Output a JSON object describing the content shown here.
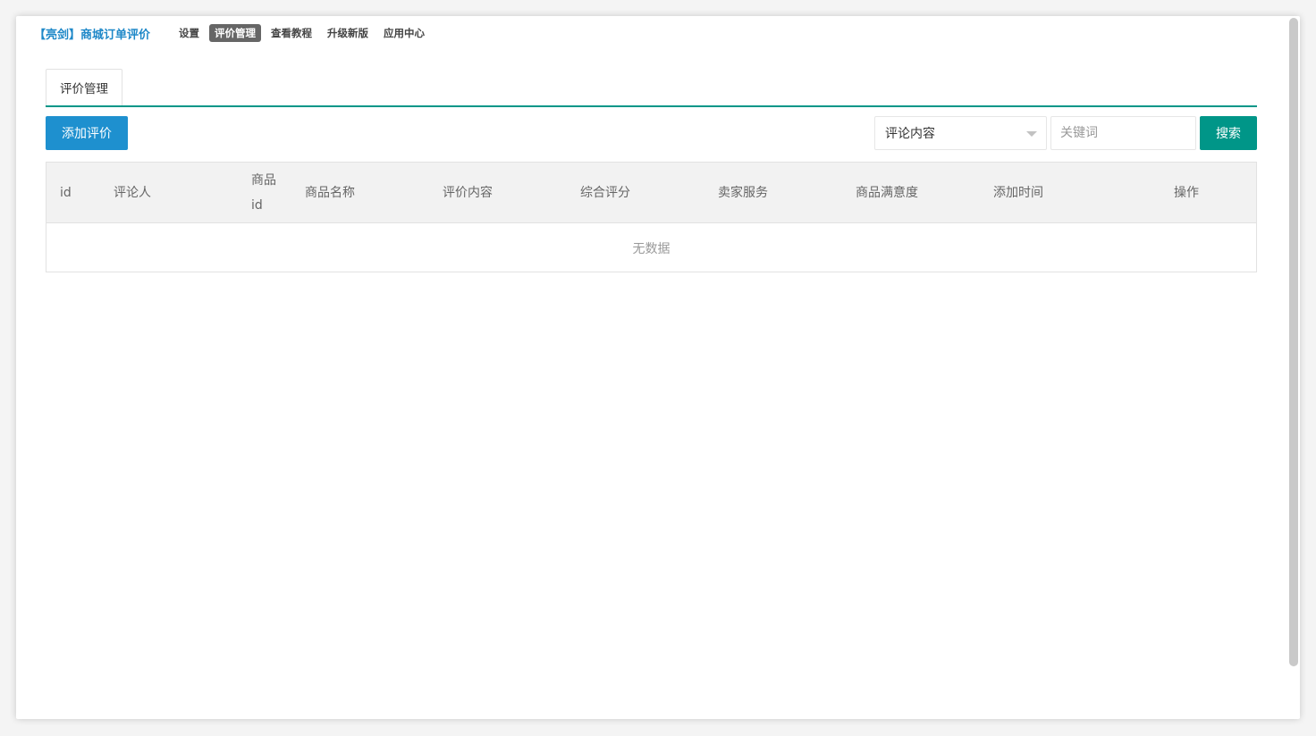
{
  "header": {
    "brand": "【亮剑】商城订单评价",
    "nav": [
      {
        "label": "设置",
        "active": false
      },
      {
        "label": "评价管理",
        "active": true
      },
      {
        "label": "查看教程",
        "active": false
      },
      {
        "label": "升级新版",
        "active": false
      },
      {
        "label": "应用中心",
        "active": false
      }
    ]
  },
  "tabs": [
    {
      "label": "评价管理"
    }
  ],
  "toolbar": {
    "add_label": "添加评价",
    "select_value": "评论内容",
    "keyword_placeholder": "关键词",
    "search_label": "搜索"
  },
  "table": {
    "columns": [
      "id",
      "评论人",
      "商品id",
      "商品名称",
      "评价内容",
      "综合评分",
      "卖家服务",
      "商品满意度",
      "添加时间",
      "操作"
    ],
    "empty_text": "无数据"
  },
  "colors": {
    "brand": "#1e88c8",
    "accent": "#009688",
    "primary_button": "#1e90cf",
    "nav_active_bg": "#666666"
  }
}
